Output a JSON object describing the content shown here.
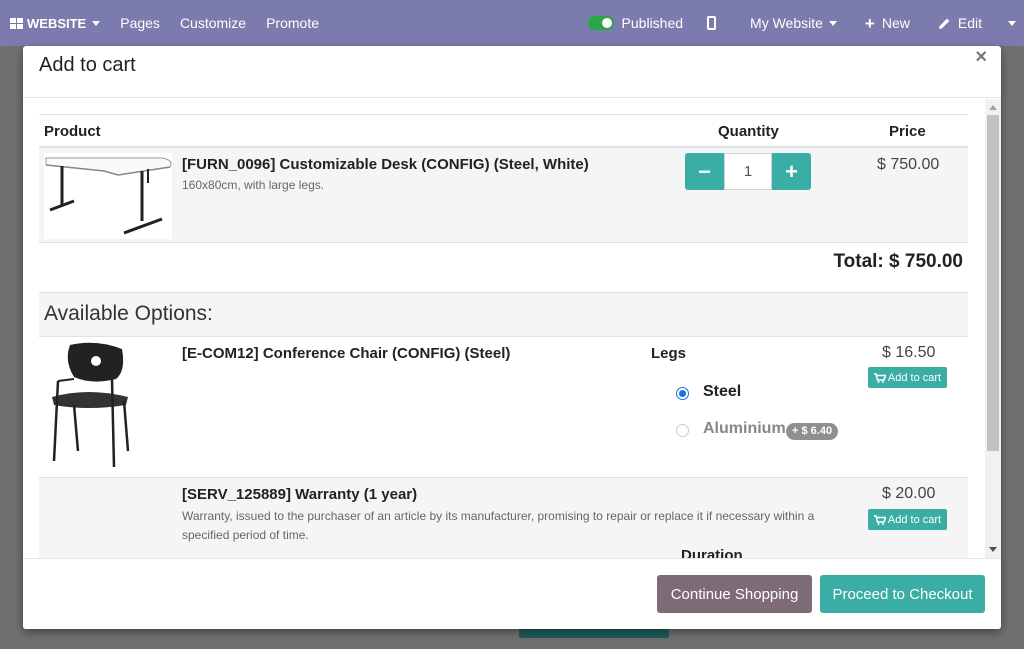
{
  "topbar": {
    "brand": "WEBSITE",
    "pages": "Pages",
    "customize": "Customize",
    "promote": "Promote",
    "published": "Published",
    "my_website": "My Website",
    "new": "New",
    "edit": "Edit",
    "background_color": "#7c7bad"
  },
  "modal": {
    "title": "Add to cart",
    "close": "×",
    "table": {
      "col_product": "Product",
      "col_quantity": "Quantity",
      "col_price": "Price"
    },
    "main_product": {
      "name": "[FURN_0096] Customizable Desk (CONFIG) (Steel, White)",
      "description": "160x80cm, with large legs.",
      "quantity": "1",
      "price": "$ 750.00",
      "image_icon": "desk-image"
    },
    "total": "Total: $ 750.00",
    "options_title": "Available Options:",
    "options": [
      {
        "name": "[E-COM12] Conference Chair (CONFIG) (Steel)",
        "attribute_label": "Legs",
        "values": [
          {
            "label": "Steel",
            "checked": true
          },
          {
            "label": "Aluminium",
            "checked": false,
            "extra": "+ $ 6.40"
          }
        ],
        "price": "$ 16.50",
        "button": "Add to cart",
        "image_icon": "chair-image"
      },
      {
        "name": "[SERV_125889] Warranty (1 year)",
        "description": "Warranty, issued to the purchaser of an article by its manufacturer, promising to repair or replace it if necessary within a specified period of time.",
        "attribute_label": "Duration",
        "price": "$ 20.00",
        "button": "Add to cart"
      }
    ],
    "footer": {
      "continue": "Continue Shopping",
      "checkout": "Proceed to Checkout"
    }
  },
  "colors": {
    "accent": "#3aada4",
    "secondary": "#7e6b78"
  }
}
